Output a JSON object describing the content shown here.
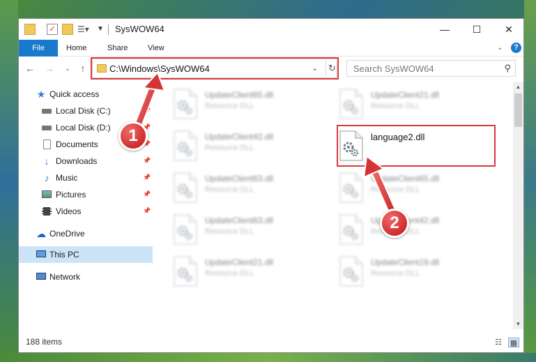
{
  "window": {
    "title": "SysWOW64",
    "controls": {
      "minimize": "—",
      "maximize": "☐",
      "close": "✕"
    }
  },
  "ribbon": {
    "tabs": [
      {
        "label": "File"
      },
      {
        "label": "Home"
      },
      {
        "label": "Share"
      },
      {
        "label": "View"
      }
    ]
  },
  "nav": {
    "address": "C:\\Windows\\SysWOW64",
    "search_placeholder": "Search SysWOW64"
  },
  "sidebar": {
    "items": [
      {
        "label": "Quick access"
      },
      {
        "label": "Local Disk (C:)"
      },
      {
        "label": "Local Disk (D:)"
      },
      {
        "label": "Documents"
      },
      {
        "label": "Downloads"
      },
      {
        "label": "Music"
      },
      {
        "label": "Pictures"
      },
      {
        "label": "Videos"
      },
      {
        "label": "OneDrive"
      },
      {
        "label": "This PC"
      },
      {
        "label": "Network"
      }
    ]
  },
  "files": [
    {
      "name": "UpdateClient65.dll",
      "type": "Resource DLL"
    },
    {
      "name": "UpdateClient21.dll",
      "type": "Resource DLL"
    },
    {
      "name": "UpdateClient42.dll",
      "type": "Resource DLL"
    },
    {
      "name": "language2.dll",
      "type": ""
    },
    {
      "name": "UpdateClient63.dll",
      "type": "Resource DLL"
    },
    {
      "name": "UpdateClient65.dll",
      "type": "Resource DLL"
    },
    {
      "name": "UpdateClient63.dll",
      "type": "Resource DLL"
    },
    {
      "name": "UpdateClient42.dll",
      "type": "Resource DLL"
    },
    {
      "name": "UpdateClient21.dll",
      "type": "Resource DLL"
    },
    {
      "name": "UpdateClient19.dll",
      "type": "Resource DLL"
    }
  ],
  "status": {
    "item_count": "188 items"
  },
  "annotations": {
    "step1": "1",
    "step2": "2"
  },
  "colors": {
    "accent": "#1979ca",
    "highlight": "#d9383e",
    "selected": "#cce4f7"
  }
}
